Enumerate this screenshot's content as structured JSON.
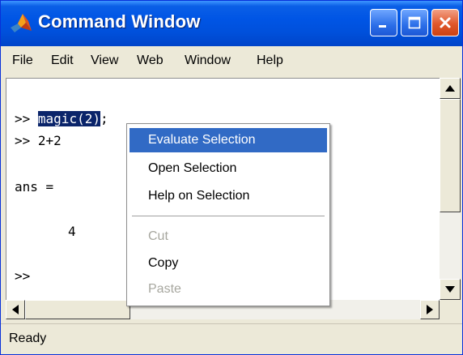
{
  "window": {
    "title": "Command Window"
  },
  "colors": {
    "title_bar": "#0054e3",
    "selection": "#0a246a",
    "menu_highlight": "#316ac5",
    "disabled_text": "#a7a79f"
  },
  "icons": {
    "app": "matlab-logo-icon",
    "minimize": "minimize-icon",
    "maximize": "maximize-icon",
    "close": "close-icon"
  },
  "menu": [
    "File",
    "Edit",
    "View",
    "Web",
    "Window",
    "Help"
  ],
  "console": {
    "line1_prompt": ">> ",
    "line1_selected": "magic(2)",
    "line1_rest": ";",
    "line2": ">> 2+2",
    "line3": "ans =",
    "line4": "4",
    "line5": ">>"
  },
  "context_menu": {
    "evaluate": "Evaluate Selection",
    "open": "Open Selection",
    "help": "Help on Selection",
    "cut": "Cut",
    "copy": "Copy",
    "paste": "Paste"
  },
  "status": {
    "text": "Ready"
  }
}
